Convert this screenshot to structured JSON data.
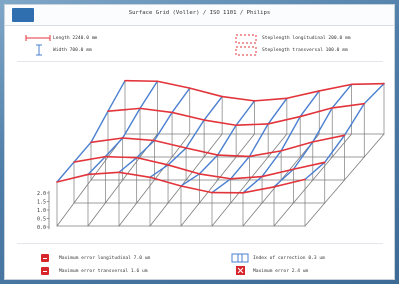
{
  "window": {
    "title": "Surface Grid (Voller) / ISO 1101 / Philips"
  },
  "icons": {
    "app": "app-icon"
  },
  "top_legend": {
    "length": "Length  2240.0 mm",
    "width": "Width  700.0 mm",
    "steplength_longitudinal": "Steplength longitudinal  200.0 mm",
    "steplength_transversal": "Steplength transversal  100.0 mm"
  },
  "axis": {
    "ticks": [
      "2.0",
      "1.5",
      "1.0",
      "0.5",
      "0.0"
    ]
  },
  "bottom_legend": {
    "max_error_longitudinal": "Maximum error longitudinal  7.0 um",
    "max_error_transversal": "Maximum error transversal  1.6 um",
    "index_of_correction": "Index of correction  0.3 um",
    "max_error": "Maximum error  2.4 um"
  },
  "colors": {
    "red": "#e2343b",
    "blue": "#4a7fd0",
    "gray": "#7c7c7c"
  }
}
